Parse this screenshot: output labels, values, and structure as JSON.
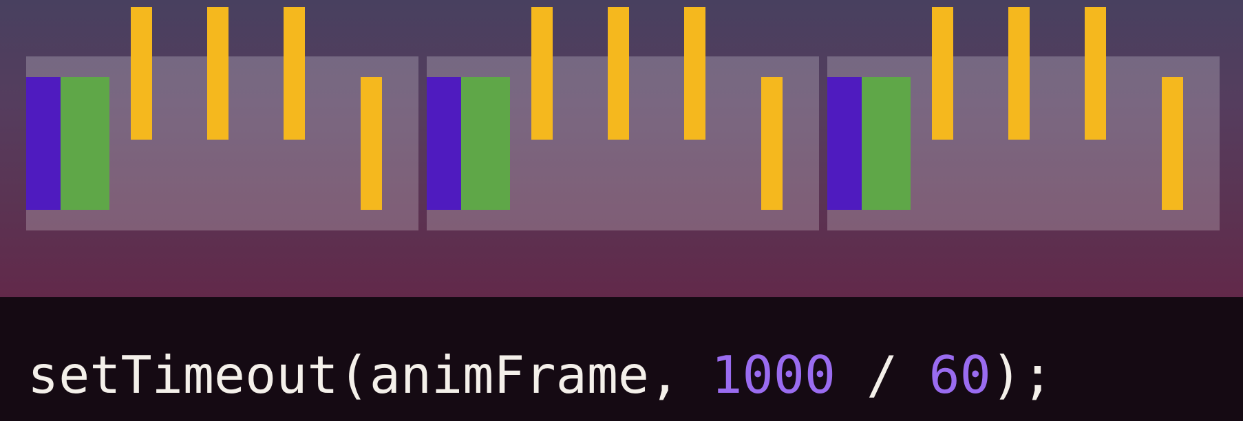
{
  "colors": {
    "purple_block": "#4f1bbf",
    "green_block": "#5fa748",
    "tick": "#f5b81e",
    "number_token": "#9a6cf0",
    "code_text": "#f4f0ea",
    "code_background": "#150a13"
  },
  "frames": [
    {
      "blocks": [
        "purple",
        "green"
      ],
      "ticks": [
        "high",
        "high",
        "high",
        "low"
      ]
    },
    {
      "blocks": [
        "purple",
        "green"
      ],
      "ticks": [
        "high",
        "high",
        "high",
        "low"
      ]
    },
    {
      "blocks": [
        "purple",
        "green"
      ],
      "ticks": [
        "high",
        "high",
        "high",
        "low"
      ]
    }
  ],
  "code": {
    "prefix": "setTimeout(animFrame, ",
    "num1": "1000",
    "op": " / ",
    "num2": "60",
    "suffix": ");"
  }
}
